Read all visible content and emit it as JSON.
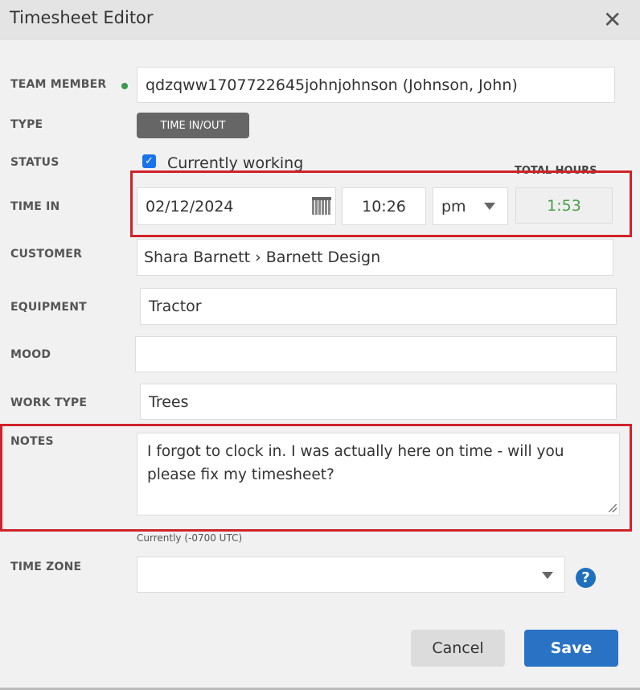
{
  "dialog": {
    "title": "Timesheet Editor"
  },
  "fields": {
    "team_member": {
      "label": "TEAM MEMBER",
      "value": "qdzqww1707722645johnjohnson (Johnson, John)"
    },
    "type": {
      "label": "TYPE",
      "value": "TIME IN/OUT"
    },
    "status": {
      "label": "STATUS",
      "checkbox_label": "Currently working",
      "checked": true
    },
    "time_in": {
      "label": "TIME IN",
      "date": "02/12/2024",
      "time": "10:26",
      "ampm": "pm"
    },
    "total_hours": {
      "label": "TOTAL HOURS",
      "value": "1:53"
    },
    "customer": {
      "label": "CUSTOMER",
      "value": "Shara Barnett › Barnett Design"
    },
    "equipment": {
      "label": "EQUIPMENT",
      "value": "Tractor"
    },
    "mood": {
      "label": "MOOD",
      "value": ""
    },
    "work_type": {
      "label": "WORK TYPE",
      "value": "Trees"
    },
    "notes": {
      "label": "NOTES",
      "value": "I forgot to clock in. I was actually here on time - will you please fix my timesheet?"
    },
    "time_zone": {
      "label": "TIME ZONE",
      "hint": "Currently (-0700 UTC)",
      "value": ""
    }
  },
  "buttons": {
    "cancel": "Cancel",
    "save": "Save"
  },
  "colors": {
    "highlight": "#d0222a",
    "save": "#2a72c4",
    "total_hours_text": "#4a9e4a",
    "online_dot": "#3a9a4a"
  }
}
